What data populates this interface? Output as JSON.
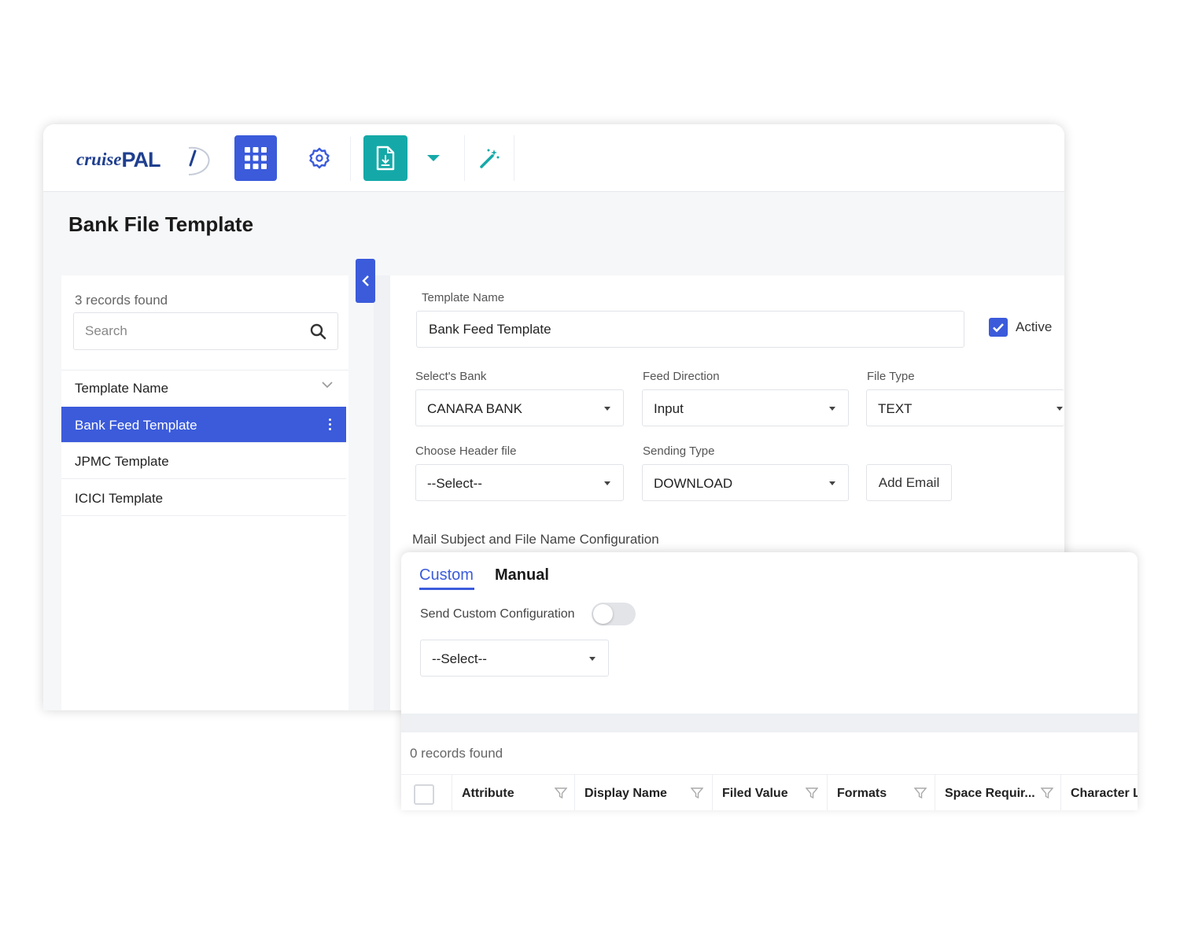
{
  "app": {
    "logo_text_1": "cruise",
    "logo_text_2": "PAL"
  },
  "toolbar": {
    "icons": [
      "apps-grid-icon",
      "gear-icon",
      "document-icon",
      "caret-down-icon",
      "magic-wand-icon"
    ],
    "accent_color": "#3b5bdb",
    "teal_color": "#14a9a8"
  },
  "page": {
    "title": "Bank File Template"
  },
  "sidebar": {
    "records_count": "3 records found",
    "search_placeholder": "Search",
    "column_header": "Template Name",
    "items": [
      {
        "label": "Bank Feed Template",
        "selected": true
      },
      {
        "label": "JPMC Template",
        "selected": false
      },
      {
        "label": "ICICI Template",
        "selected": false
      }
    ]
  },
  "form": {
    "template_name_label": "Template Name",
    "template_name_value": "Bank Feed Template",
    "active_label": "Active",
    "active_checked": true,
    "bank_label": "Select's Bank",
    "bank_value": "CANARA BANK",
    "feed_direction_label": "Feed Direction",
    "feed_direction_value": "Input",
    "file_type_label": "File Type",
    "file_type_value": "TEXT",
    "header_file_label": "Choose Header file",
    "header_file_value": "--Select--",
    "sending_type_label": "Sending Type",
    "sending_type_value": "DOWNLOAD",
    "add_email_label": "Add Email",
    "mail_config_label": "Mail Subject and File Name Configuration"
  },
  "config_card": {
    "tabs": [
      {
        "label": "Custom",
        "active": true
      },
      {
        "label": "Manual",
        "active": false
      }
    ],
    "toggle_label": "Send Custom Configuration",
    "toggle_on": false,
    "select_value": "--Select--",
    "records_count": "0 records found",
    "columns": [
      "Attribute",
      "Display Name",
      "Filed Value",
      "Formats",
      "Space Requir...",
      "Character L"
    ]
  }
}
